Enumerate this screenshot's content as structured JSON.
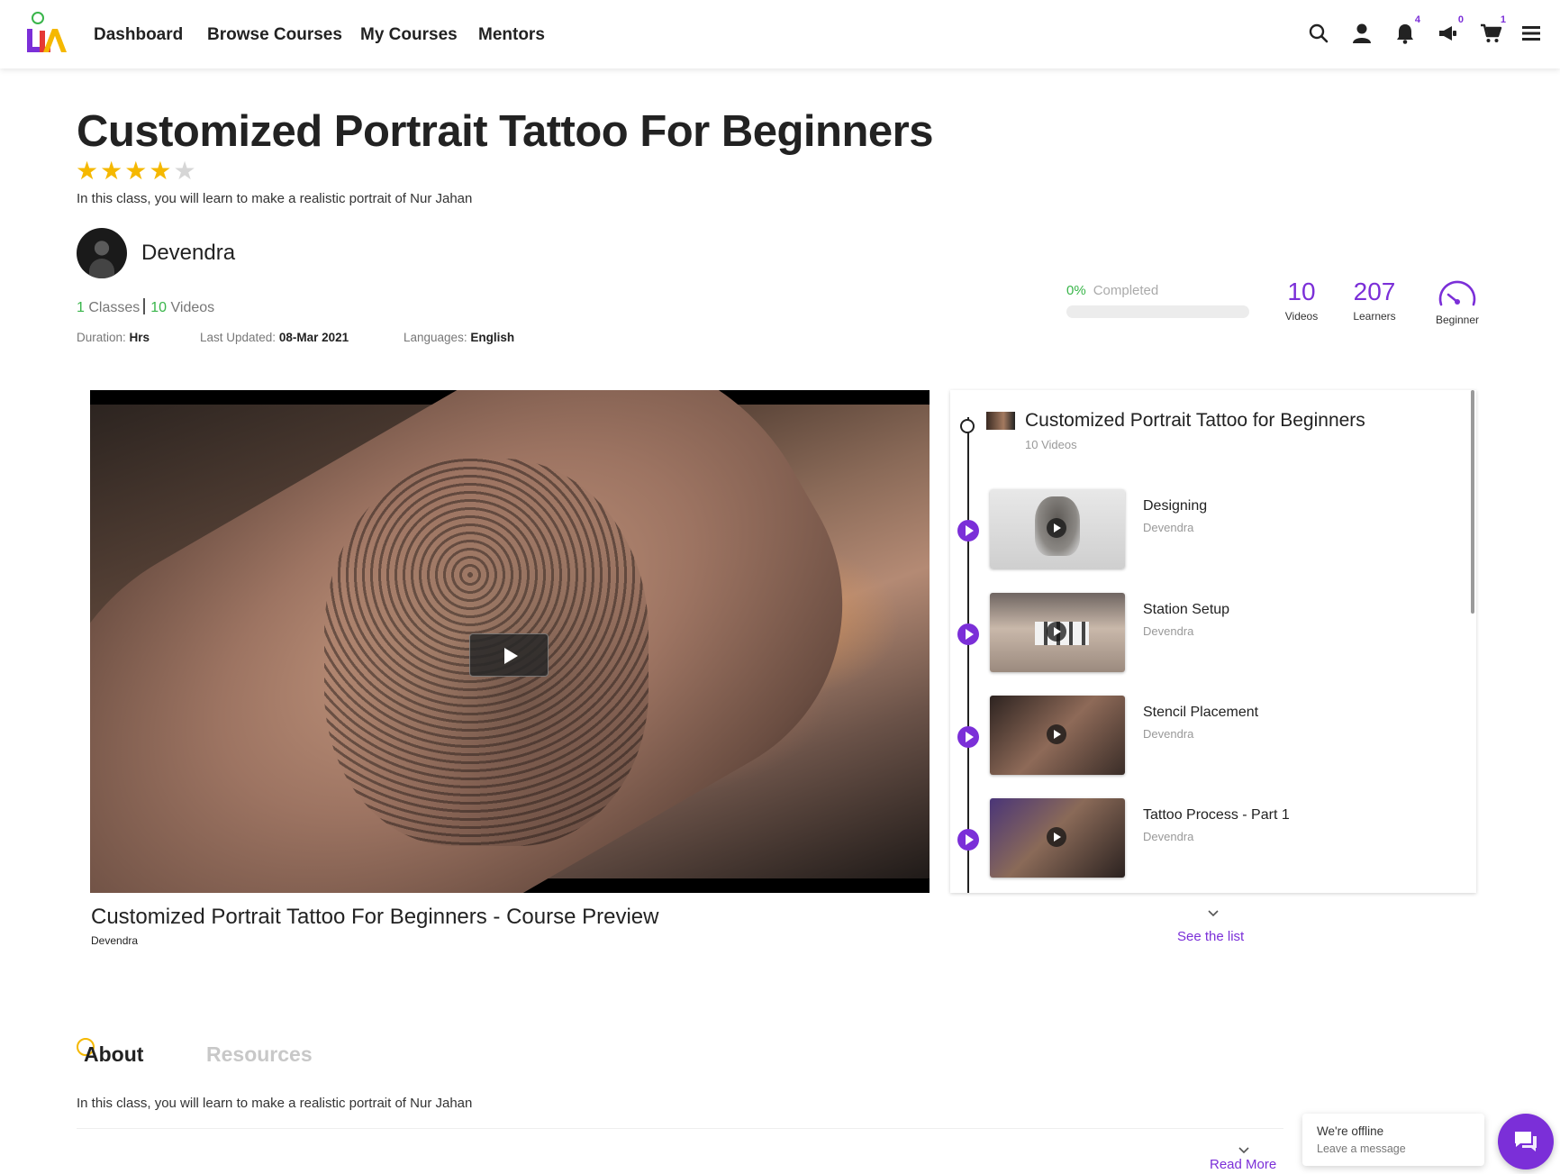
{
  "nav": {
    "links": [
      "Dashboard",
      "Browse Courses",
      "My Courses",
      "Mentors"
    ],
    "icons": [
      "search-icon",
      "user-icon",
      "bell-icon",
      "megaphone-icon",
      "cart-icon",
      "menu-icon"
    ],
    "badges": {
      "notifications": "4",
      "announcements": "0",
      "cart": "1"
    }
  },
  "course": {
    "title": "Customized Portrait Tattoo For Beginners",
    "rating": 4,
    "rating_max": 5,
    "description": "In this class, you will learn to make a realistic portrait of Nur Jahan",
    "mentor": "Devendra",
    "classes_count": "1",
    "classes_label": "Classes",
    "videos_count": "10",
    "videos_label": "Videos",
    "duration_label": "Duration:",
    "duration_value": "Hrs",
    "updated_label": "Last Updated:",
    "updated_value": "08-Mar 2021",
    "languages_label": "Languages:",
    "languages_value": "English"
  },
  "stats": {
    "progress_percent": "0%",
    "progress_value": 0,
    "progress_label": "Completed",
    "videos_value": "10",
    "videos_label": "Videos",
    "learners_value": "207",
    "learners_label": "Learners",
    "level_label": "Beginner"
  },
  "video": {
    "title": "Customized Portrait Tattoo For Beginners - Course Preview",
    "author": "Devendra"
  },
  "playlist": {
    "title": "Customized Portrait Tattoo for Beginners",
    "subtitle": "10 Videos",
    "items": [
      {
        "title": "Designing",
        "author": "Devendra"
      },
      {
        "title": "Station Setup",
        "author": "Devendra"
      },
      {
        "title": "Stencil Placement",
        "author": "Devendra"
      },
      {
        "title": "Tattoo Process - Part 1",
        "author": "Devendra"
      }
    ],
    "see_list": "See the list"
  },
  "tabs": {
    "about": "About",
    "resources": "Resources",
    "about_text": "In this class, you will learn to make a realistic portrait of Nur Jahan",
    "read_more": "Read More"
  },
  "chat": {
    "title": "We're offline",
    "subtitle": "Leave a message"
  },
  "colors": {
    "accent": "#7b2fd8",
    "success": "#39b54a",
    "star": "#f5b800"
  }
}
